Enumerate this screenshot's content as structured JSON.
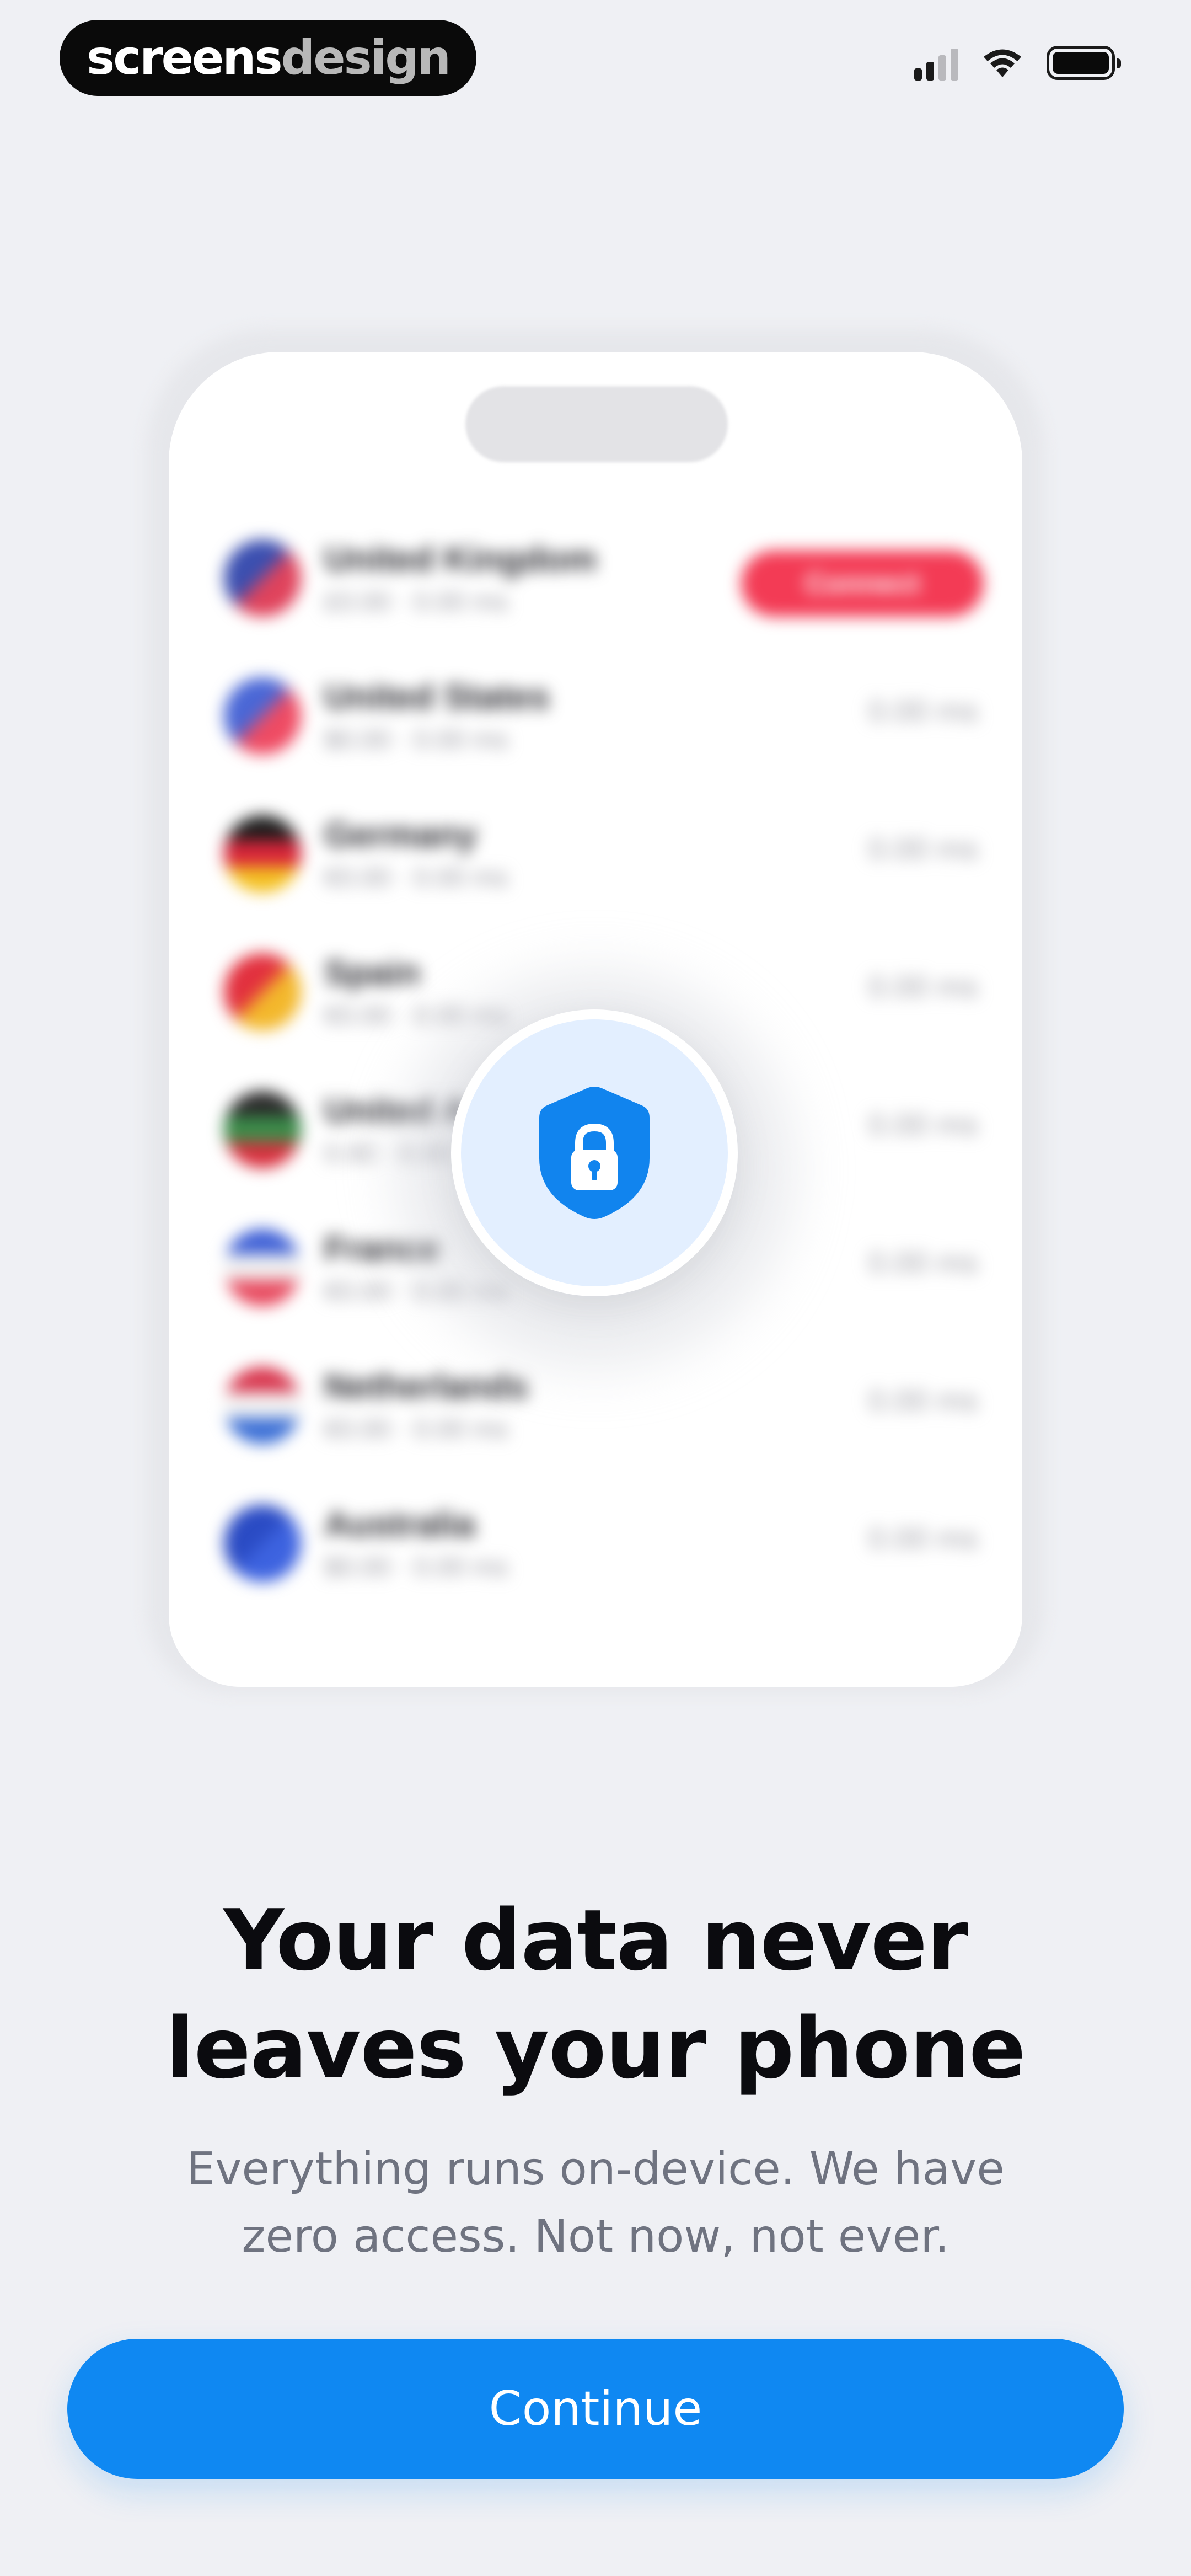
{
  "status_bar": {
    "watermark_primary": "screens",
    "watermark_secondary": "design",
    "icons": [
      "signal-icon",
      "wifi-icon",
      "battery-icon"
    ]
  },
  "illustration": {
    "rows": [
      {
        "name": "United Kingdom",
        "sub": "£0.00 · 0.00 ms",
        "flag_colors": [
          "#3b4fb0",
          "#e0435c"
        ],
        "action": "Connect"
      },
      {
        "name": "United States",
        "sub": "$0.00 · 0.00 ms",
        "flag_colors": [
          "#4a67d6",
          "#ef4b63"
        ],
        "value": "0.00 ms"
      },
      {
        "name": "Germany",
        "sub": "€0.00 · 0.00 ms",
        "flag_colors": [
          "#1b1b1b",
          "#d8253a",
          "#f4c021"
        ],
        "value": "0.00 ms"
      },
      {
        "name": "Spain",
        "sub": "€0.00 · 0.00 ms",
        "flag_colors": [
          "#e2303e",
          "#f3b82c"
        ],
        "value": "0.00 ms"
      },
      {
        "name": "United Arab Emirates",
        "sub": "0.00 · 0.00 ms",
        "flag_colors": [
          "#2a2a2a",
          "#3b8d4a",
          "#d8303e"
        ],
        "value": "0.00 ms"
      },
      {
        "name": "France",
        "sub": "€0.00 · 0.00 ms",
        "flag_colors": [
          "#3d5fd6",
          "#f1f1f1",
          "#e84a5f"
        ],
        "value": "0.00 ms"
      },
      {
        "name": "Netherlands",
        "sub": "€0.00 · 0.00 ms",
        "flag_colors": [
          "#d8354d",
          "#f3f3f3",
          "#3b6fd6"
        ],
        "value": "0.00 ms"
      },
      {
        "name": "Australia",
        "sub": "$0.00 · 0.00 ms",
        "flag_colors": [
          "#2a4bc4",
          "#3d63e0"
        ],
        "value": "0.00 ms"
      }
    ],
    "badge_icon": "shield-lock-icon",
    "accent": "#1184ee"
  },
  "content": {
    "headline_line1": "Your data never",
    "headline_line2": "leaves your phone",
    "subtitle_line1": "Everything runs on-device. We have",
    "subtitle_line2": "zero access. Not now, not ever."
  },
  "actions": {
    "continue_label": "Continue"
  }
}
